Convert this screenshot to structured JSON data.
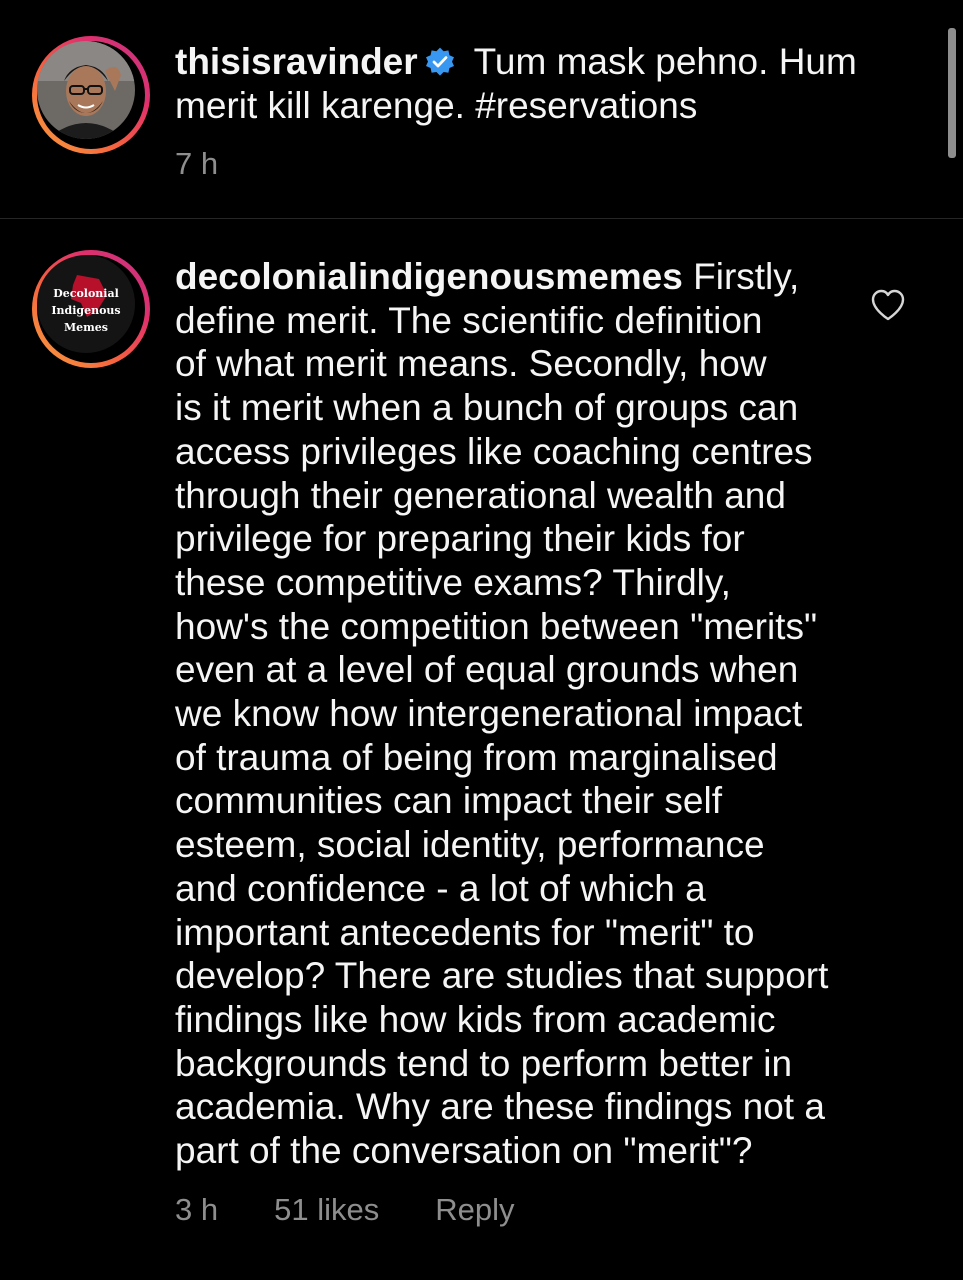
{
  "caption": {
    "username": "thisisravinder",
    "text": "Tum mask pehno. Hum merit kill karenge. #reservations",
    "time": "7 h"
  },
  "comment": {
    "username": "decolonialindigenousmemes",
    "text": "Firstly,\ndefine merit. The scientific definition\nof what merit means. Secondly, how\nis it merit when a bunch of groups can\naccess privileges like coaching centres\nthrough their generational wealth and\nprivilege for preparing their kids for\nthese competitive exams? Thirdly,\nhow's the competition between \"merits\"\neven at a level of equal grounds when\nwe know how intergenerational impact\nof trauma of being from marginalised\ncommunities can impact their self\nesteem, social identity, performance\nand confidence - a lot of which a\nimportant antecedents for \"merit\" to\ndevelop? There are studies that support\nfindings like how kids from academic\nbackgrounds tend to perform better in\nacademia. Why are these findings not a\npart of the conversation on \"merit\"?",
    "time": "3 h",
    "likes": "51 likes",
    "reply_label": "Reply",
    "avatar_logo_lines": [
      "Decolonial",
      "Indigenous",
      "Memes"
    ]
  },
  "icons": {
    "verified": "verified-badge-icon",
    "like": "heart-outline-icon"
  },
  "colors": {
    "background": "#000000",
    "text": "#f5f5f5",
    "secondary": "#8e8e8e",
    "verified_blue": "#3897f0",
    "logo_red": "#c8102e"
  }
}
